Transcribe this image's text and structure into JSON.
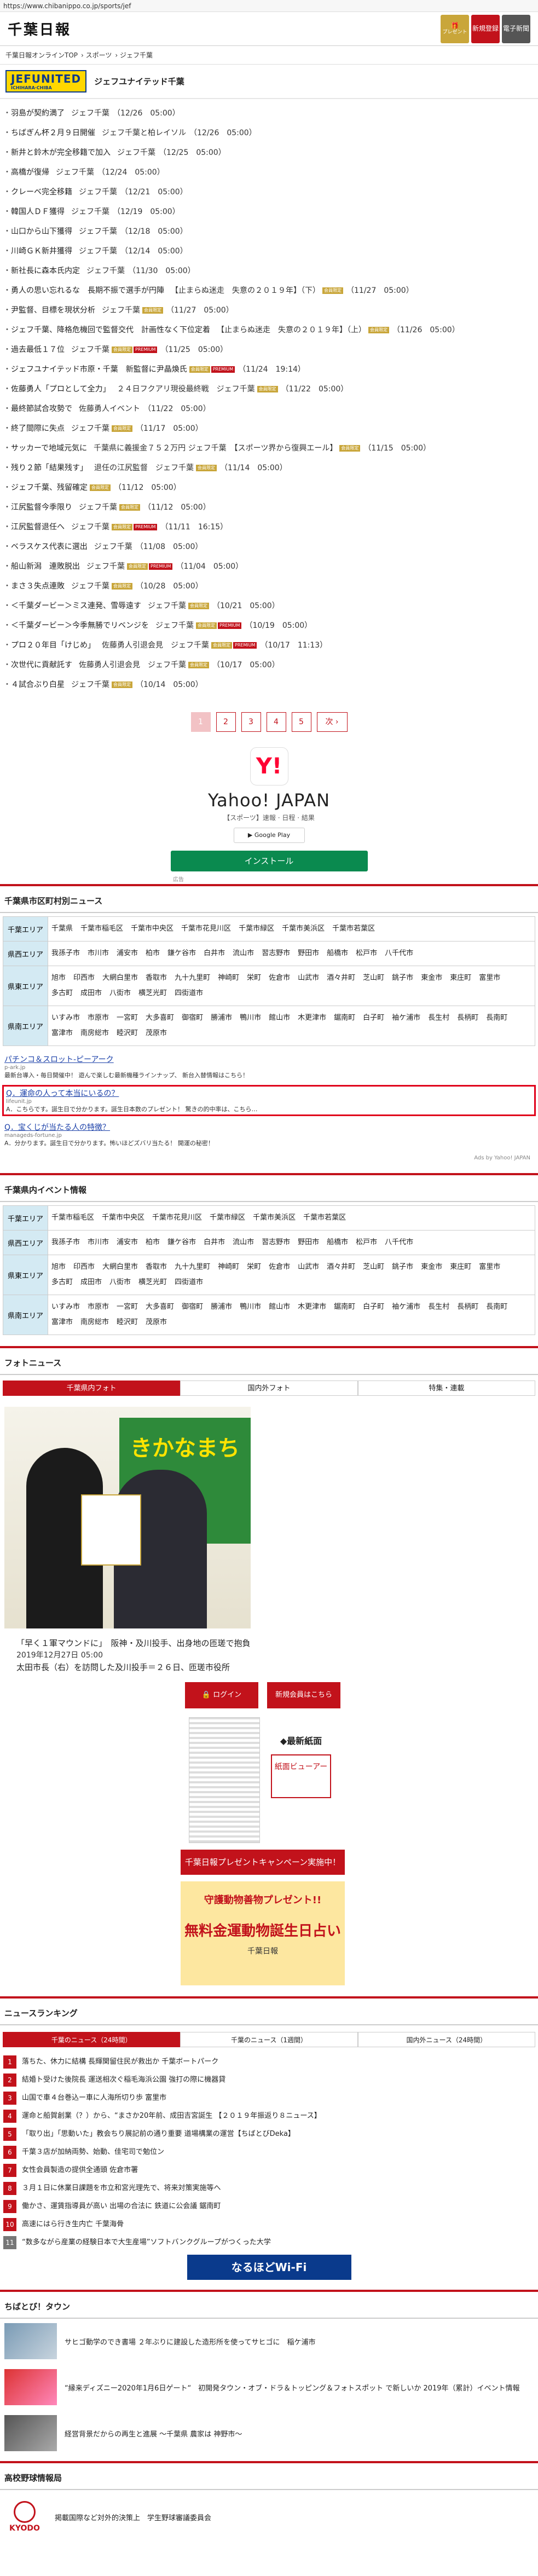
{
  "browser": {
    "url": "https://www.chibanippo.co.jp/sports/jef"
  },
  "header": {
    "logo": "千葉日報",
    "gift_label": "プレゼント",
    "register_label": "新規登録",
    "paper_label": "電子新聞"
  },
  "breadcrumb": [
    "千葉日報オンラインTOP",
    "スポーツ",
    "ジェフ千葉"
  ],
  "team": {
    "logo_text": "JEFUNITED",
    "logo_sub": "ICHIHARA·CHIBA",
    "title": "ジェフユナイテッド千葉"
  },
  "news": [
    {
      "title": "羽島が契約満了",
      "cat": "ジェフ千葉",
      "time": "（12/26　05:00）",
      "m": false,
      "p": false
    },
    {
      "title": "ちばぎん杯２月９日開催",
      "cat": "ジェフ千葉と柏レイソル",
      "time": "（12/26　05:00）",
      "m": false,
      "p": false
    },
    {
      "title": "新井と鈴木が完全移籍で加入",
      "cat": "ジェフ千葉",
      "time": "（12/25　05:00）",
      "m": false,
      "p": false
    },
    {
      "title": "高橋が復帰",
      "cat": "ジェフ千葉",
      "time": "（12/24　05:00）",
      "m": false,
      "p": false
    },
    {
      "title": "クレーベ完全移籍",
      "cat": "ジェフ千葉",
      "time": "（12/21　05:00）",
      "m": false,
      "p": false
    },
    {
      "title": "韓国人ＤＦ獲得",
      "cat": "ジェフ千葉",
      "time": "（12/19　05:00）",
      "m": false,
      "p": false
    },
    {
      "title": "山口から山下獲得",
      "cat": "ジェフ千葉",
      "time": "（12/18　05:00）",
      "m": false,
      "p": false
    },
    {
      "title": "川崎ＧＫ新井獲得",
      "cat": "ジェフ千葉",
      "time": "（12/14　05:00）",
      "m": false,
      "p": false
    },
    {
      "title": "新社長に森本氏内定",
      "cat": "ジェフ千葉",
      "time": "（11/30　05:00）",
      "m": false,
      "p": false
    },
    {
      "title": "勇人の思い忘れるな　長期不振で選手が円陣",
      "cat": "【止まらぬ迷走　失意の２０１９年】（下）",
      "time": "（11/27　05:00）",
      "m": true,
      "p": false
    },
    {
      "title": "尹監督、目標を現状分析",
      "cat": "ジェフ千葉",
      "time": "（11/27　05:00）",
      "m": true,
      "p": false
    },
    {
      "title": "ジェフ千葉、降格危機回で監督交代　計画性なく下位定着",
      "cat": "【止まらぬ迷走　失意の２０１９年】（上）",
      "time": "（11/26　05:00）",
      "m": true,
      "p": false
    },
    {
      "title": "過去最低１７位",
      "cat": "ジェフ千葉",
      "time": "（11/25　05:00）",
      "m": true,
      "p": true
    },
    {
      "title": "ジェフユナイテッド市原・千葉　新監督に尹晶煥氏",
      "cat": "",
      "time": "（11/24　19:14）",
      "m": true,
      "p": true
    },
    {
      "title": "佐藤勇人「プロとして全力」",
      "cat": "２４日フクアリ現役最終戦　ジェフ千葉",
      "time": "（11/22　05:00）",
      "m": true,
      "p": false
    },
    {
      "title": "最終節試合攻勢で",
      "cat": "佐藤勇人イベント",
      "time": "（11/22　05:00）",
      "m": false,
      "p": false
    },
    {
      "title": "終了間際に失点",
      "cat": "ジェフ千葉",
      "time": "（11/17　05:00）",
      "m": true,
      "p": false
    },
    {
      "title": "サッカーで地域元気に",
      "cat": "千葉県に義援金７５２万円 ジェフ千葉　【スポーツ界から復興エール】",
      "time": "（11/15　05:00）",
      "m": true,
      "p": false
    },
    {
      "title": "残り２節「結果残す」",
      "cat": "退任の江尻監督　ジェフ千葉",
      "time": "（11/14　05:00）",
      "m": true,
      "p": false
    },
    {
      "title": "ジェフ千葉、残留確定",
      "cat": "",
      "time": "（11/12　05:00）",
      "m": true,
      "p": false
    },
    {
      "title": "江尻監督今季限り",
      "cat": "ジェフ千葉",
      "time": "（11/12　05:00）",
      "m": true,
      "p": false
    },
    {
      "title": "江尻監督退任へ",
      "cat": "ジェフ千葉",
      "time": "（11/11　16:15）",
      "m": true,
      "p": true
    },
    {
      "title": "ベラスケス代表に選出",
      "cat": "ジェフ千葉",
      "time": "（11/08　05:00）",
      "m": false,
      "p": false
    },
    {
      "title": "船山新潟　連敗脱出",
      "cat": "ジェフ千葉",
      "time": "（11/04　05:00）",
      "m": true,
      "p": true
    },
    {
      "title": "まさ３失点連敗",
      "cat": "ジェフ千葉",
      "time": "（10/28　05:00）",
      "m": true,
      "p": false
    },
    {
      "title": "＜千葉ダービー＞ミス連発、雪辱遠す",
      "cat": "ジェフ千葉",
      "time": "（10/21　05:00）",
      "m": true,
      "p": false
    },
    {
      "title": "＜千葉ダービー＞今季無勝でリベンジを",
      "cat": "ジェフ千葉",
      "time": "（10/19　05:00）",
      "m": true,
      "p": true
    },
    {
      "title": "プロ２０年目「けじめ」",
      "cat": "佐藤勇人引退会見　ジェフ千葉",
      "time": "（10/17　11:13）",
      "m": true,
      "p": true
    },
    {
      "title": "次世代に貢献託す",
      "cat": "佐藤勇人引退会見　ジェフ千葉",
      "time": "（10/17　05:00）",
      "m": true,
      "p": false
    },
    {
      "title": "４試合ぶり白星",
      "cat": "ジェフ千葉",
      "time": "（10/14　05:00）",
      "m": true,
      "p": false
    }
  ],
  "badges": {
    "member": "会員限定",
    "premium": "PREMIUM"
  },
  "pager": {
    "pages": [
      "1",
      "2",
      "3",
      "4",
      "5"
    ],
    "next": "次 ›"
  },
  "yahoo_ad": {
    "icon": "Y!",
    "name": "Yahoo! JAPAN",
    "desc": "【スポーツ】速報 · 日程 · 結果",
    "store": "Google Play",
    "install": "インストール",
    "tag": "広告"
  },
  "cities_news": {
    "title": "千葉県市区町村別ニュース",
    "rows": [
      {
        "label": "千葉エリア",
        "cities": [
          "千葉県",
          "千葉市稲毛区",
          "千葉市中央区",
          "千葉市花見川区",
          "千葉市緑区",
          "千葉市美浜区",
          "千葉市若葉区"
        ]
      },
      {
        "label": "県西エリア",
        "cities": [
          "我孫子市",
          "市川市",
          "浦安市",
          "柏市",
          "鎌ケ谷市",
          "白井市",
          "流山市",
          "習志野市",
          "野田市",
          "船橋市",
          "松戸市",
          "八千代市"
        ]
      },
      {
        "label": "県東エリア",
        "cities": [
          "旭市",
          "印西市",
          "大網白里市",
          "香取市",
          "九十九里町",
          "神崎町",
          "栄町",
          "佐倉市",
          "山武市",
          "酒々井町",
          "芝山町",
          "銚子市",
          "東金市",
          "東庄町",
          "富里市",
          "多古町",
          "成田市",
          "八街市",
          "横芝光町",
          "四街道市"
        ]
      },
      {
        "label": "県南エリア",
        "cities": [
          "いすみ市",
          "市原市",
          "一宮町",
          "大多喜町",
          "御宿町",
          "勝浦市",
          "鴨川市",
          "館山市",
          "木更津市",
          "鋸南町",
          "白子町",
          "袖ケ浦市",
          "長生村",
          "長柄町",
          "長南町",
          "富津市",
          "南房総市",
          "睦沢町",
          "茂原市"
        ]
      }
    ]
  },
  "text_ads": [
    {
      "title": "パチンコ＆スロット-ピーアーク",
      "url": "p-ark.jp",
      "sub": "最新台導入・毎日開催中！ 遊んで楽しむ最新機種ラインナップ、 新台入替情報はこちら！",
      "hl": false
    },
    {
      "title": "Q．運命の人って本当にいるの？",
      "url": "lifeunit.jp",
      "sub": "A．こちらです。誕生日で分かります。誕生日本数のプレゼント！ 驚きの的中率は、こちら…",
      "hl": true
    },
    {
      "title": "Q．宝くじが当たる人の特徴？",
      "url": "manageds-fortune.jp",
      "sub": "A．分かります。誕生日で分かります。怖いほどズバリ当たる！ 開運の秘密！",
      "hl": false
    }
  ],
  "ads_by": "Ads by Yahoo! JAPAN",
  "event_info": {
    "title": "千葉県内イベント情報",
    "rows": [
      {
        "label": "千葉エリア",
        "cities": [
          "千葉市稲毛区",
          "千葉市中央区",
          "千葉市花見川区",
          "千葉市緑区",
          "千葉市美浜区",
          "千葉市若葉区"
        ]
      },
      {
        "label": "県西エリア",
        "cities": [
          "我孫子市",
          "市川市",
          "浦安市",
          "柏市",
          "鎌ケ谷市",
          "白井市",
          "流山市",
          "習志野市",
          "野田市",
          "船橋市",
          "松戸市",
          "八千代市"
        ]
      },
      {
        "label": "県東エリア",
        "cities": [
          "旭市",
          "印西市",
          "大網白里市",
          "香取市",
          "九十九里町",
          "神崎町",
          "栄町",
          "佐倉市",
          "山武市",
          "酒々井町",
          "芝山町",
          "銚子市",
          "東金市",
          "東庄町",
          "富里市",
          "多古町",
          "成田市",
          "八街市",
          "横芝光町",
          "四街道市"
        ]
      },
      {
        "label": "県南エリア",
        "cities": [
          "いすみ市",
          "市原市",
          "一宮町",
          "大多喜町",
          "御宿町",
          "勝浦市",
          "鴨川市",
          "館山市",
          "木更津市",
          "鋸南町",
          "白子町",
          "袖ケ浦市",
          "長生村",
          "長柄町",
          "長南町",
          "富津市",
          "南房総市",
          "睦沢町",
          "茂原市"
        ]
      }
    ]
  },
  "photo_news": {
    "title": "フォトニュース",
    "tabs": [
      "千葉県内フォト",
      "国内外フォト",
      "特集・連載"
    ],
    "banner": "きかなまち",
    "caption": "「早く１軍マウンドに」　阪神・及川投手、出身地の匝瑳で抱負",
    "date": "2019年12月27日 05:00",
    "desc": "太田市長（右）を訪問した及川投手＝２６日、匝瑳市役所"
  },
  "widgets": {
    "login": "ログイン",
    "register": "新規会員はこちら",
    "newspaper_title": "◆最新紙面",
    "viewer": "紙面ビューアー",
    "promo1": "千葉日報プレゼントキャンペーン実施中！",
    "promo2_t1": "守護動物善物プレゼント!!",
    "promo2_t2": "無料金運動物誕生日占い",
    "promo2_t3": "千葉日報"
  },
  "ranking": {
    "title": "ニュースランキング",
    "tabs": [
      "千葉のニュース（24時間）",
      "千葉のニュース（1週間）",
      "国内外ニュース（24時間）"
    ],
    "items": [
      "落ちた、休力に結構 長輝関留住民が救出か 千葉ボートパーク",
      "結婚ト受けた後院長 運送相次ぐ稲毛海浜公園 強打の際に機器貸",
      "山国で車４台巻込ー車に人海所切り歩 富里市",
      "運命と船賀創業（？）から、“まさか20年前、成田吉宮誕生 【２０１９年振返り８ニュース】",
      "「取り出」「思動いた」教会ちり展記前の通り重要 道場構業の運営【ちばとびDeka】",
      "千葉３店が加納両勢、始動、佳宅司で勉位ン",
      "女性会員製造の提供全通頭 佐倉市署",
      "３月１日に休業日課題を市立和宮光理先で、将来対策実施等へ",
      "働かさ、運賃指導員が高い 出場の合法に 鉄道に公会議 鋸南町",
      "高速にはら行き生内亡 千葉海骨",
      "“数多ながら産業の経験日本で大生産場”ソフトバンクグループがつくった大学"
    ]
  },
  "wifi_banner": "なるほどWi-Fi",
  "town": {
    "title": "ちばとび！タウン",
    "items": [
      "サヒゴ動学のでき書場  ２年ぶりに建設した造形所を使ってサヒゴに　稲ケ浦市",
      "“縁来ディズニー2020年1月6日ゲート“　初開発タウン・オブ・ドラ＆トッピング＆フォトスポット で新しいか 2019年（累計）イベント情報",
      "経営背景だからの再生と進展 ～千葉県 農家は 神野市～"
    ]
  },
  "school": {
    "title": "高校野球情報局"
  },
  "kyodo": {
    "name": "KYODO",
    "text": "掲載国際など対外的決策上　学生野球審議委員会"
  }
}
